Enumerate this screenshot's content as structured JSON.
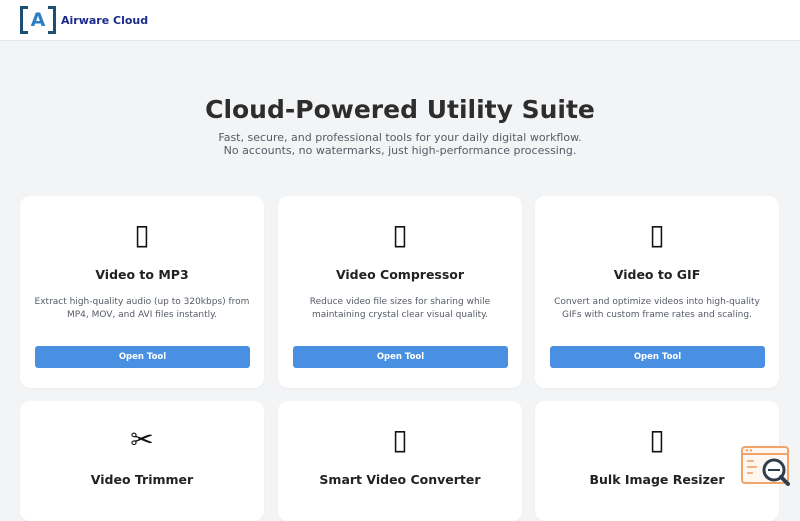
{
  "header": {
    "logo_letter": "A",
    "brand_name": "Airware Cloud"
  },
  "hero": {
    "title": "Cloud-Powered Utility Suite",
    "subtitle_line1": "Fast, secure, and professional tools for your daily digital workflow.",
    "subtitle_line2": "No accounts, no watermarks, just high-performance processing."
  },
  "tools": [
    {
      "icon": "missing-glyph",
      "glyph": "▯",
      "title": "Video to MP3",
      "description": "Extract high-quality audio (up to 320kbps) from MP4, MOV, and AVI files instantly.",
      "button": "Open Tool"
    },
    {
      "icon": "missing-glyph",
      "glyph": "▯",
      "title": "Video Compressor",
      "description": "Reduce video file sizes for sharing while maintaining crystal clear visual quality.",
      "button": "Open Tool"
    },
    {
      "icon": "missing-glyph",
      "glyph": "▯",
      "title": "Video to GIF",
      "description": "Convert and optimize videos into high-quality GIFs with custom frame rates and scaling.",
      "button": "Open Tool"
    },
    {
      "icon": "scissors-icon",
      "glyph": "✂",
      "title": "Video Trimmer"
    },
    {
      "icon": "missing-glyph",
      "glyph": "▯",
      "title": "Smart Video Converter"
    },
    {
      "icon": "missing-glyph",
      "glyph": "▯",
      "title": "Bulk Image Resizer"
    }
  ],
  "colors": {
    "accent_button": "#4a90e2",
    "brand_text": "#1a2b8a",
    "page_background": "#f3f4f6",
    "fab_orange": "#f0a46b"
  }
}
